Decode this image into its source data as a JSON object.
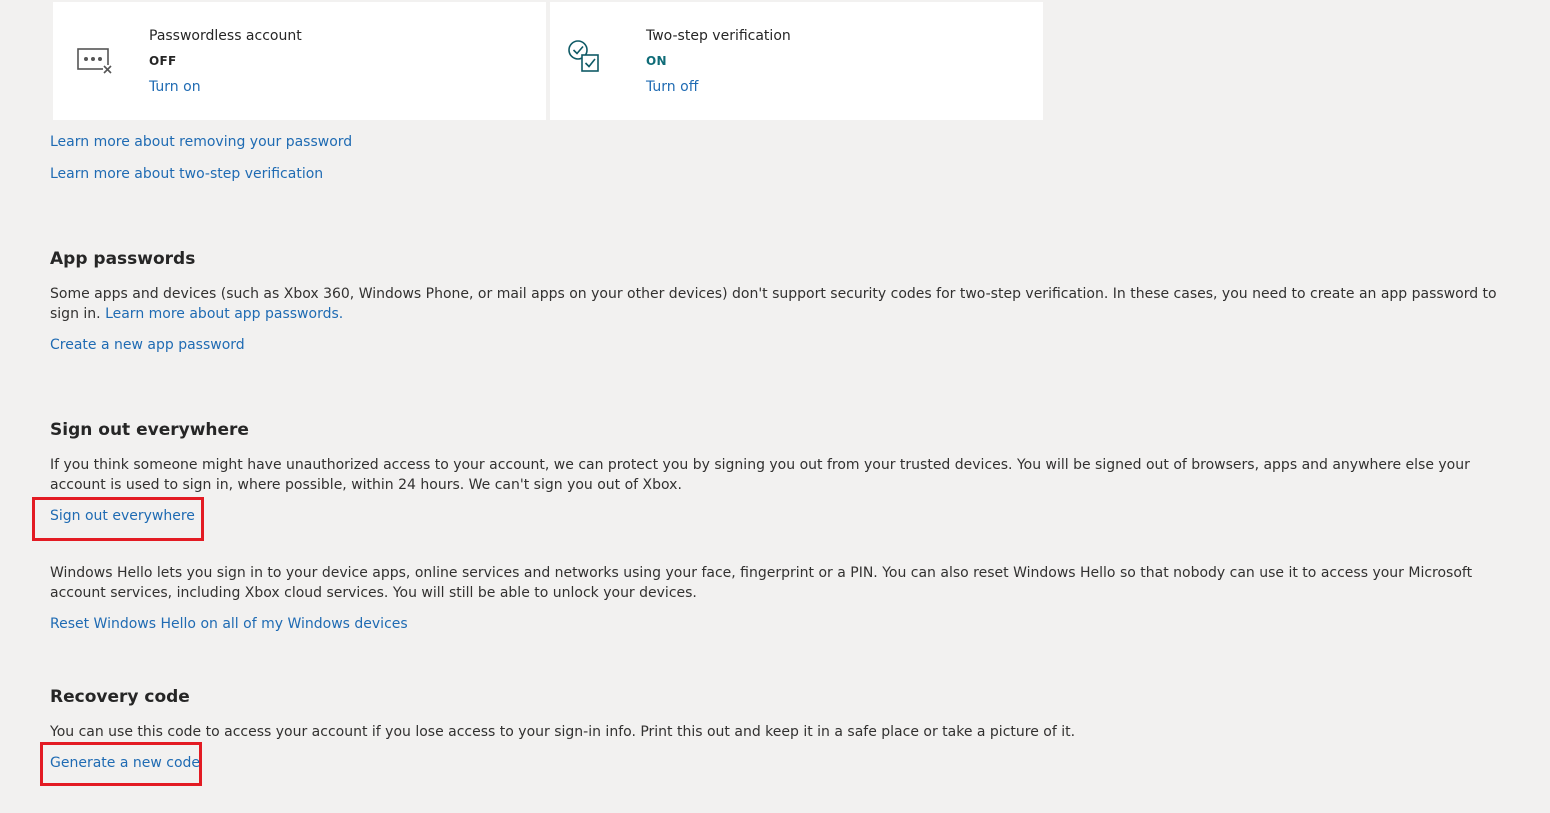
{
  "cards": {
    "passwordless": {
      "title": "Passwordless account",
      "status": "OFF",
      "action": "Turn on"
    },
    "two_step": {
      "title": "Two-step verification",
      "status": "ON",
      "action": "Turn off"
    }
  },
  "links": {
    "learn_removing_password": "Learn more about removing your password",
    "learn_two_step": "Learn more about two-step verification"
  },
  "app_passwords": {
    "heading": "App passwords",
    "description": "Some apps and devices (such as Xbox 360, Windows Phone, or mail apps on your other devices) don't support security codes for two-step verification. In these cases, you need to create an app password to sign in.",
    "learn_more": "Learn more about app passwords.",
    "create_link": "Create a new app password"
  },
  "sign_out": {
    "heading": "Sign out everywhere",
    "description": "If you think someone might have unauthorized access to your account, we can protect you by signing you out from your trusted devices. You will be signed out of browsers, apps and anywhere else your account is used to sign in, where possible, within 24 hours. We can't sign you out of Xbox.",
    "link": "Sign out everywhere"
  },
  "windows_hello": {
    "description": "Windows Hello lets you sign in to your device apps, online services and networks using your face, fingerprint or a PIN. You can also reset Windows Hello so that nobody can use it to access your Microsoft account services, including Xbox cloud services. You will still be able to unlock your devices.",
    "link": "Reset Windows Hello on all of my Windows devices"
  },
  "recovery": {
    "heading": "Recovery code",
    "description": "You can use this code to access your account if you lose access to your sign-in info. Print this out and keep it in a safe place or take a picture of it.",
    "link": "Generate a new code"
  },
  "colors": {
    "link": "#1f6bb3",
    "status_off": "#262626",
    "status_on": "#0f6c78",
    "highlight": "#e31b23",
    "background": "#f2f1f0"
  }
}
